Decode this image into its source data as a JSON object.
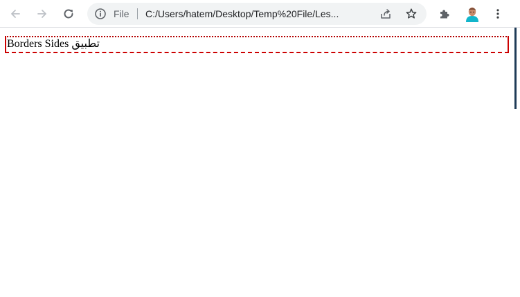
{
  "browser": {
    "address_bar": {
      "scheme_label": "File",
      "url": "C:/Users/hatem/Desktop/Temp%20File/Les..."
    },
    "icons": {
      "back": "back-arrow-icon",
      "forward": "forward-arrow-icon",
      "reload": "reload-icon",
      "info": "info-icon",
      "share": "share-icon",
      "bookmark": "star-icon",
      "extensions": "puzzle-icon",
      "profile": "avatar",
      "menu": "more-vert-icon"
    }
  },
  "page": {
    "demo_text": "Borders Sides تطبيق",
    "border_color": "#cc0000"
  }
}
